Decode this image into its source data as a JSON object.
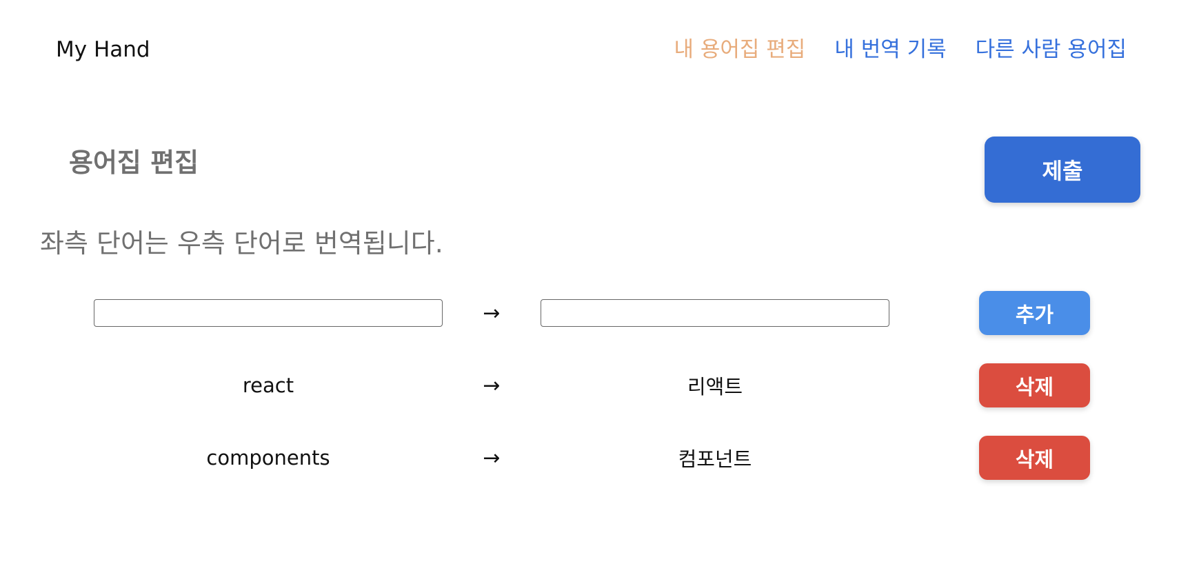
{
  "header": {
    "logo": "My Hand",
    "nav": [
      {
        "label": "내 용어집 편집",
        "active": true
      },
      {
        "label": "내 번역 기록",
        "active": false
      },
      {
        "label": "다른 사람 용어집",
        "active": false
      }
    ]
  },
  "main": {
    "title": "용어집 편집",
    "submit_label": "제출",
    "description": "좌측 단어는 우측 단어로 번역됩니다.",
    "arrow": "→",
    "new_entry": {
      "source_value": "",
      "target_value": "",
      "add_label": "추가"
    },
    "entries": [
      {
        "source": "react",
        "target": "리액트",
        "delete_label": "삭제"
      },
      {
        "source": "components",
        "target": "컴포넌트",
        "delete_label": "삭제"
      }
    ]
  },
  "colors": {
    "nav_active": "#e8ac7c",
    "nav_link": "#3570dc",
    "submit": "#346dd4",
    "add": "#4a8ee8",
    "delete": "#db4d3f"
  }
}
